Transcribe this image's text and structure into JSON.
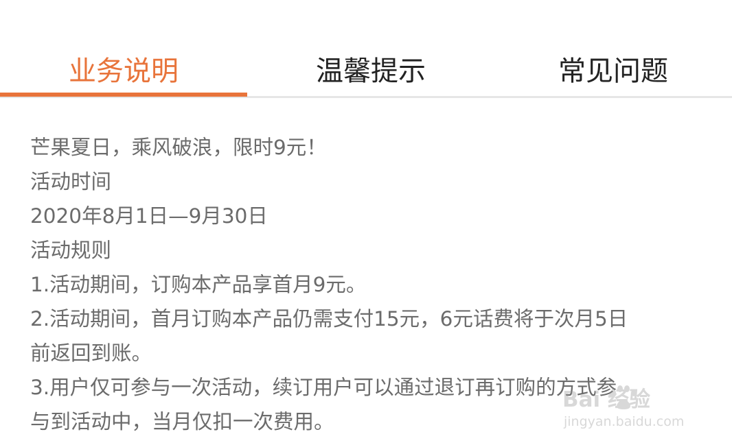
{
  "tabs": {
    "items": [
      {
        "label": "业务说明"
      },
      {
        "label": "温馨提示"
      },
      {
        "label": "常见问题"
      }
    ],
    "active_color": "#e8743b"
  },
  "content": {
    "lines": [
      "芒果夏日，乘风破浪，限时9元！",
      "活动时间",
      "2020年8月1日—9月30日",
      "活动规则",
      "1.活动期间，订购本产品享首月9元。",
      "2.活动期间，首月订购本产品仍需支付15元，6元话费将于次月5日",
      "前返回到账。",
      "3.用户仅可参与一次活动，续订用户可以通过退订再订购的方式参",
      "与到活动中，当月仅扣一次费用。"
    ]
  },
  "watermark": {
    "text": "Bai 经验",
    "url": "jingyan.baidu.com"
  }
}
